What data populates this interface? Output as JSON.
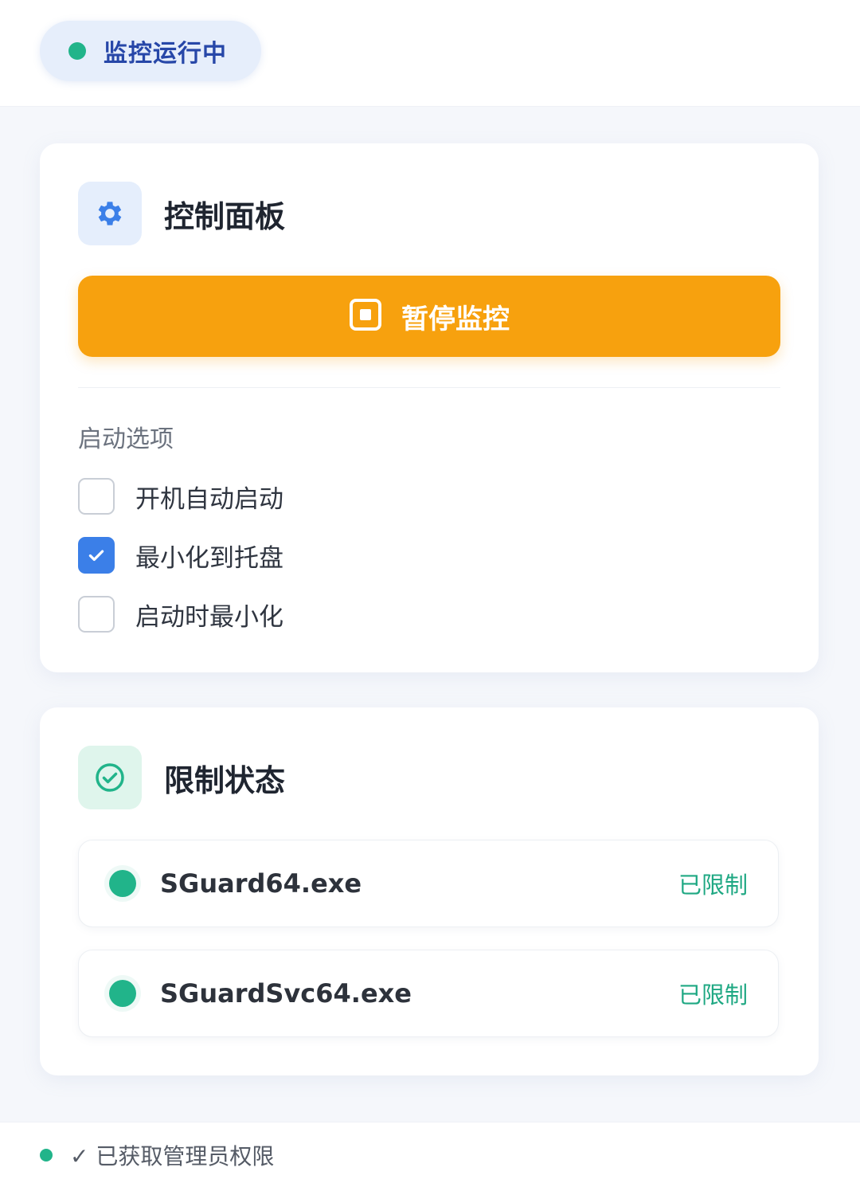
{
  "header": {
    "status_text": "监控运行中",
    "status_color": "#21b48a"
  },
  "control_panel": {
    "title": "控制面板",
    "icon": "gear-icon",
    "pause_button": {
      "label": "暂停监控",
      "icon": "stop-icon",
      "color": "#f7a10e"
    },
    "startup_section_label": "启动选项",
    "options": [
      {
        "label": "开机自动启动",
        "checked": false
      },
      {
        "label": "最小化到托盘",
        "checked": true
      },
      {
        "label": "启动时最小化",
        "checked": false
      }
    ]
  },
  "restriction_status": {
    "title": "限制状态",
    "icon": "check-circle-icon",
    "processes": [
      {
        "name": "SGuard64.exe",
        "state": "已限制"
      },
      {
        "name": "SGuardSvc64.exe",
        "state": "已限制"
      }
    ]
  },
  "footer": {
    "text": "✓ 已获取管理员权限"
  },
  "colors": {
    "accent_blue": "#3b7fe8",
    "success_green": "#21b48a",
    "warning_orange": "#f7a10e"
  }
}
